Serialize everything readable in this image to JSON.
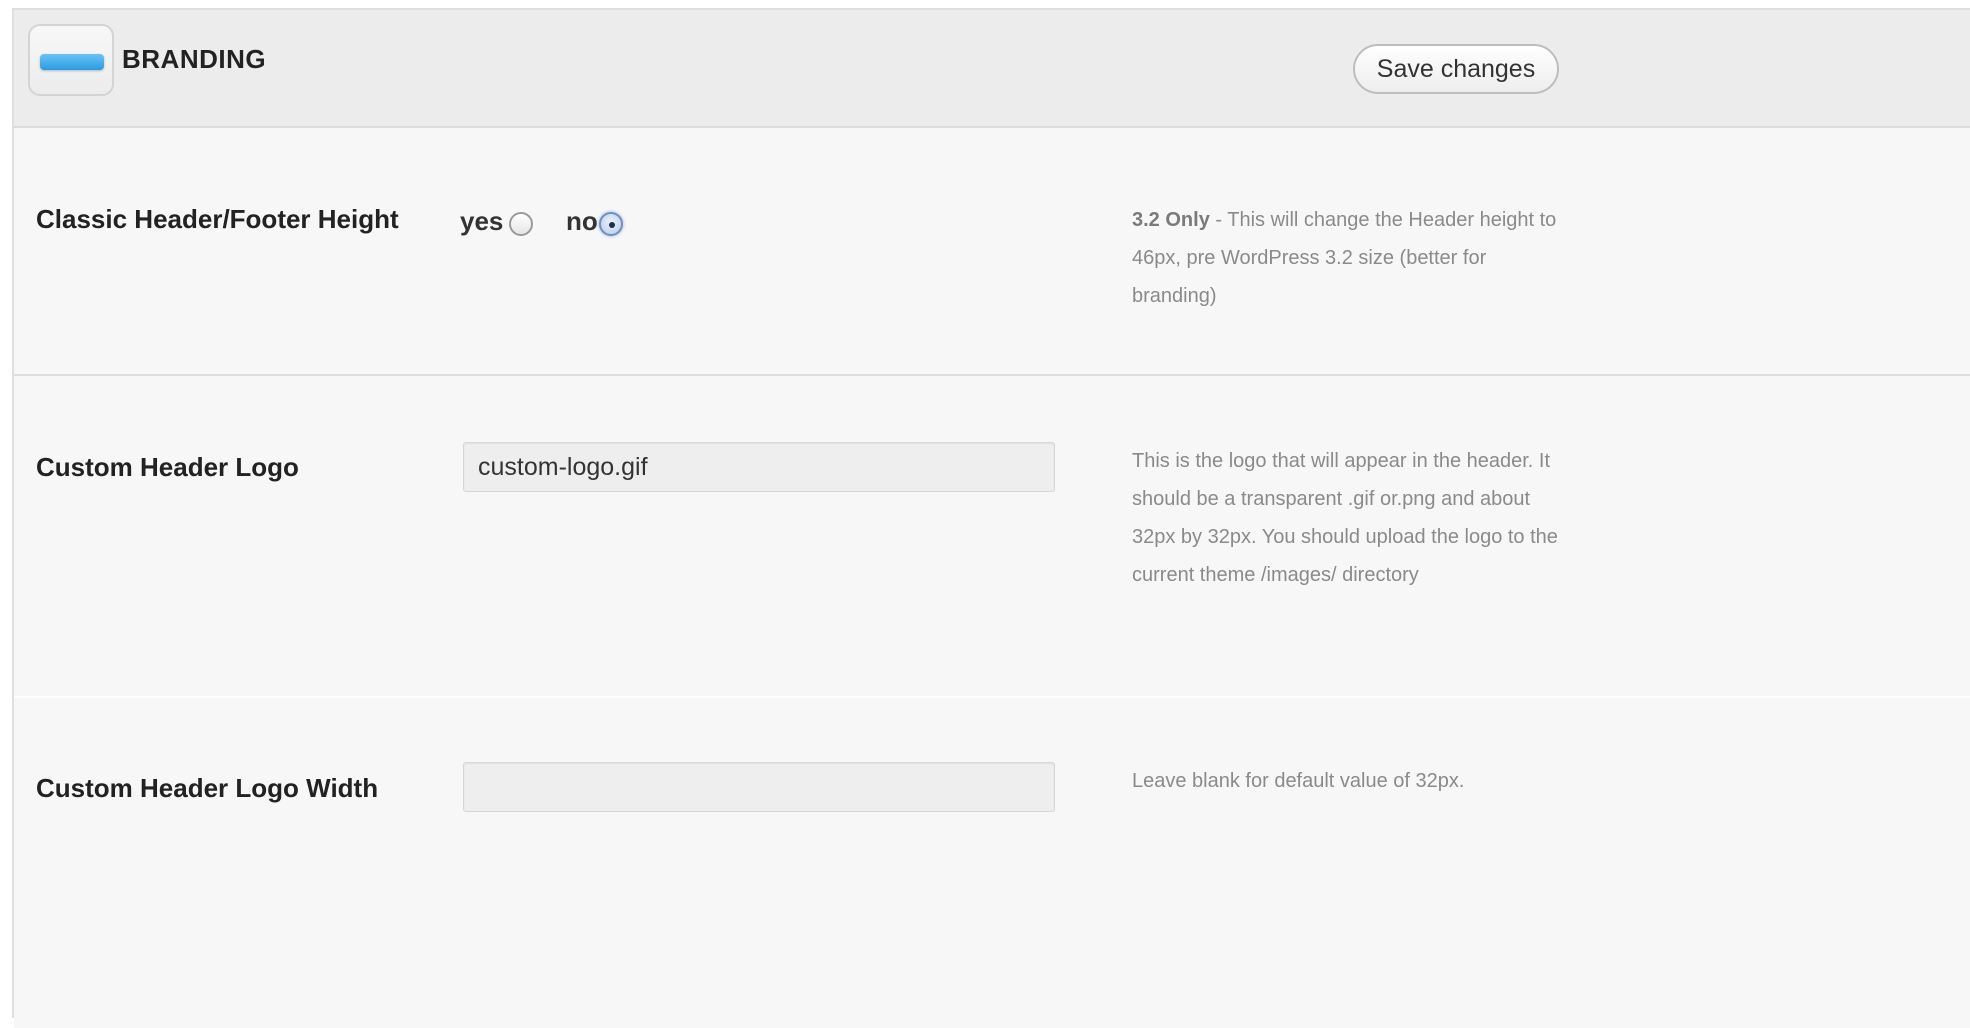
{
  "section": {
    "title": "BRANDING",
    "icon": "branding-bar-icon",
    "save_label": "Save changes"
  },
  "options": [
    {
      "label": "Classic Header/Footer Height",
      "type": "radio",
      "choices": [
        {
          "label": "yes",
          "checked": false
        },
        {
          "label": "no",
          "checked": true
        }
      ],
      "description_strong": "3.2 Only",
      "description": " - This will change the Header height to 46px, pre WordPress 3.2 size (better for branding)"
    },
    {
      "label": "Custom Header Logo",
      "type": "text",
      "value": "custom-logo.gif",
      "description": "This is the logo that will appear in the header. It should be a transparent .gif or.png and about 32px by 32px. You should upload the logo to the current theme /images/ directory"
    },
    {
      "label": "Custom Header Logo Width",
      "type": "text",
      "value": "",
      "description": "Leave blank for default value of 32px."
    }
  ],
  "colors": {
    "accent_blue": "#2a9ae2",
    "panel_bg": "#f7f7f7",
    "header_bg": "#ececec"
  }
}
